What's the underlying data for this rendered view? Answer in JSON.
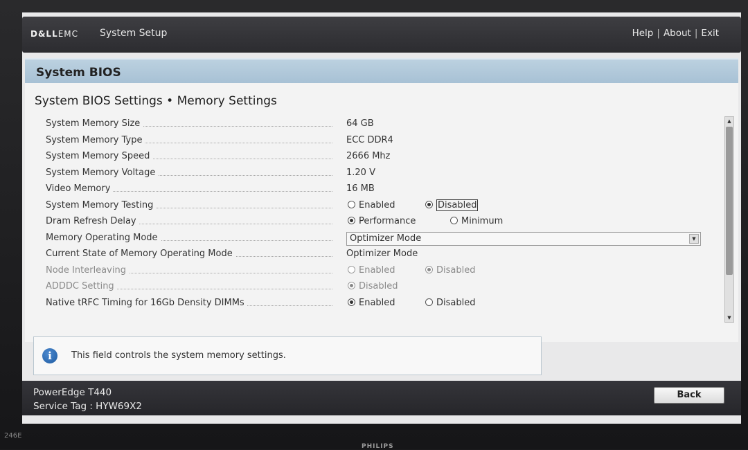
{
  "header": {
    "brand_bold": "D&LL",
    "brand_light": "EMC",
    "app_title": "System Setup",
    "links": [
      "Help",
      "About",
      "Exit"
    ],
    "separator": "|"
  },
  "bios_title": "System BIOS",
  "breadcrumb": "System BIOS Settings • Memory Settings",
  "settings": {
    "rows": [
      {
        "label": "System Memory Size",
        "value": "64 GB"
      },
      {
        "label": "System Memory Type",
        "value": "ECC DDR4"
      },
      {
        "label": "System Memory Speed",
        "value": "2666 Mhz"
      },
      {
        "label": "System Memory Voltage",
        "value": "1.20 V"
      },
      {
        "label": "Video Memory",
        "value": "16 MB"
      },
      {
        "label": "System Memory Testing",
        "options": [
          "Enabled",
          "Disabled"
        ],
        "selected": "Disabled"
      },
      {
        "label": "Dram Refresh Delay",
        "options": [
          "Performance",
          "Minimum"
        ],
        "selected": "Performance"
      },
      {
        "label": "Memory Operating Mode",
        "dropdown_value": "Optimizer Mode"
      },
      {
        "label": "Current State of Memory Operating Mode",
        "value": "Optimizer Mode"
      },
      {
        "label": "Node Interleaving",
        "options": [
          "Enabled",
          "Disabled"
        ],
        "selected": "Disabled",
        "disabled": true
      },
      {
        "label": "ADDDC Setting",
        "options": [
          "Disabled"
        ],
        "selected": "Disabled",
        "disabled": true
      },
      {
        "label": "Native tRFC Timing for 16Gb Density DIMMs",
        "options": [
          "Enabled",
          "Disabled"
        ],
        "selected": "Enabled"
      }
    ]
  },
  "help_text": "This field controls the system memory settings.",
  "footer": {
    "model": "PowerEdge T440",
    "service_tag": "Service Tag : HYW69X2",
    "back_label": "Back"
  },
  "monitor": {
    "model": "246E",
    "brand": "PHILIPS"
  },
  "colors": {
    "band": "#a6c0d4",
    "topbar": "#2c2c30"
  },
  "icons": [
    "info-icon",
    "chevron-down-icon",
    "scroll-up-icon",
    "scroll-down-icon"
  ]
}
